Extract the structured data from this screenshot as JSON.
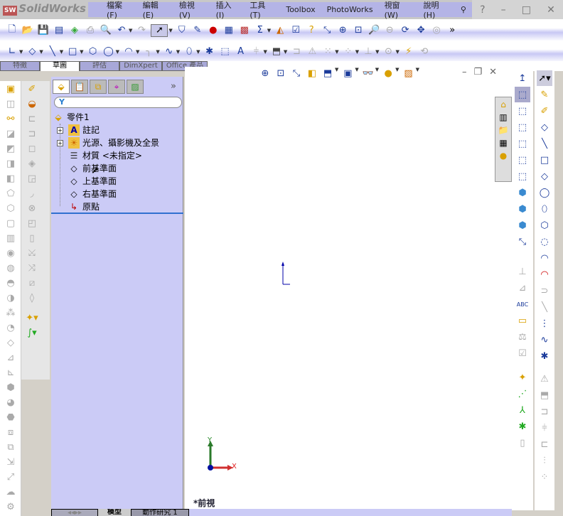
{
  "app": {
    "title": "SolidWorks",
    "logo_text": "SW"
  },
  "menu": [
    "檔案(F)",
    "編輯(E)",
    "檢視(V)",
    "插入(I)",
    "工具(T)",
    "Toolbox",
    "PhotoWorks",
    "視窗(W)",
    "說明(H)"
  ],
  "window_controls": {
    "help": "?",
    "minimize": "–",
    "maximize": "□",
    "close": "✕"
  },
  "toolbar_more": "»",
  "command_tabs": [
    "特徵",
    "草圖",
    "評估",
    "DimXpert",
    "Office 產品"
  ],
  "active_command_tab": "草圖",
  "feature_manager": {
    "more": "»",
    "filter_icon": "Y",
    "root": "零件1",
    "items": [
      {
        "label": "註記",
        "expandable": true,
        "icon": "annotation-folder-icon"
      },
      {
        "label": "光源、攝影機及全景",
        "expandable": true,
        "icon": "lights-folder-icon"
      },
      {
        "label": "材質 <未指定>",
        "expandable": false,
        "icon": "material-icon"
      },
      {
        "label": "前基準面",
        "expandable": false,
        "icon": "plane-icon"
      },
      {
        "label": "上基準面",
        "expandable": false,
        "icon": "plane-icon"
      },
      {
        "label": "右基準面",
        "expandable": false,
        "icon": "plane-icon"
      },
      {
        "label": "原點",
        "expandable": false,
        "icon": "origin-icon"
      }
    ]
  },
  "viewport": {
    "view_name": "*前視",
    "axis_x": "X",
    "axis_y": "Y"
  },
  "bottom_tabs": [
    "模型",
    "動作研究 1"
  ],
  "active_bottom_tab": "模型"
}
